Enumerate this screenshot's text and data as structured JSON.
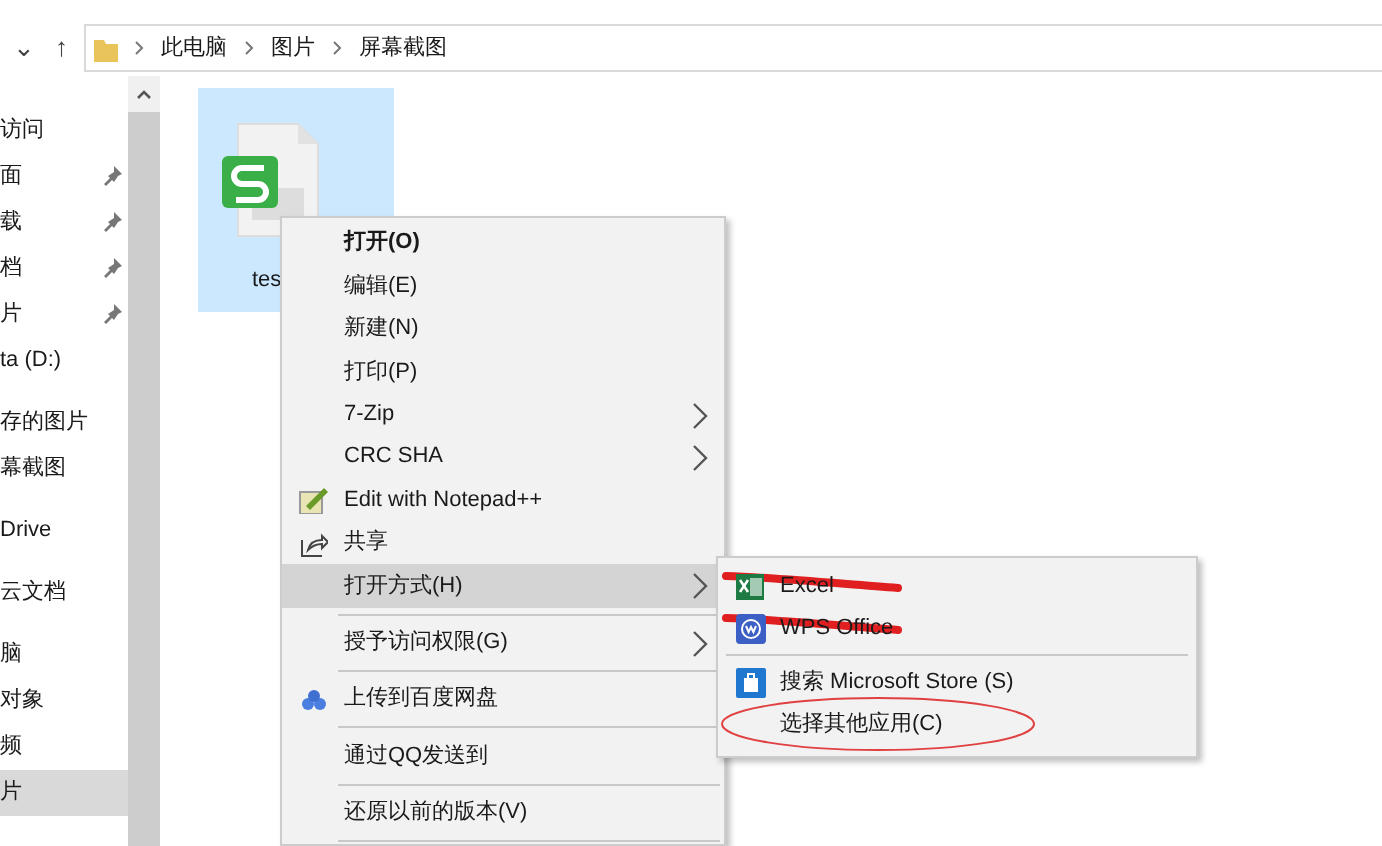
{
  "toolbar": {
    "back_glyph": "⌄",
    "up_glyph": "↑"
  },
  "address_bar": {
    "path": [
      "此电脑",
      "图片",
      "屏幕截图"
    ]
  },
  "nav_pane": {
    "items": [
      {
        "label": "访问",
        "pinned": false,
        "selected": false
      },
      {
        "label": "面",
        "pinned": true,
        "selected": false
      },
      {
        "label": "载",
        "pinned": true,
        "selected": false
      },
      {
        "label": "档",
        "pinned": true,
        "selected": false
      },
      {
        "label": "片",
        "pinned": true,
        "selected": false
      },
      {
        "label": "ta (D:)",
        "pinned": false,
        "selected": false
      },
      {
        "label": "存的图片",
        "pinned": false,
        "selected": false
      },
      {
        "label": "幕截图",
        "pinned": false,
        "selected": false
      },
      {
        "label": "Drive",
        "pinned": false,
        "selected": false
      },
      {
        "label": "云文档",
        "pinned": false,
        "selected": false
      },
      {
        "label": "脑",
        "pinned": false,
        "selected": false
      },
      {
        "label": "对象",
        "pinned": false,
        "selected": false
      },
      {
        "label": "频",
        "pinned": false,
        "selected": false
      },
      {
        "label": "片",
        "pinned": false,
        "selected": true
      }
    ]
  },
  "file": {
    "name": "tes",
    "selected": true
  },
  "context_menu": {
    "items": [
      {
        "kind": "item",
        "label": "打开(O)",
        "bold": true,
        "submenu": false,
        "highlighted": false
      },
      {
        "kind": "item",
        "label": "编辑(E)",
        "bold": false,
        "submenu": false,
        "highlighted": false
      },
      {
        "kind": "item",
        "label": "新建(N)",
        "bold": false,
        "submenu": false,
        "highlighted": false
      },
      {
        "kind": "item",
        "label": "打印(P)",
        "bold": false,
        "submenu": false,
        "highlighted": false
      },
      {
        "kind": "item",
        "label": "7-Zip",
        "bold": false,
        "submenu": true,
        "highlighted": false
      },
      {
        "kind": "item",
        "label": "CRC SHA",
        "bold": false,
        "submenu": true,
        "highlighted": false
      },
      {
        "kind": "item",
        "label": "Edit with Notepad++",
        "bold": false,
        "submenu": false,
        "highlighted": false
      },
      {
        "kind": "item",
        "label": "共享",
        "bold": false,
        "submenu": false,
        "highlighted": false
      },
      {
        "kind": "item",
        "label": "打开方式(H)",
        "bold": false,
        "submenu": true,
        "highlighted": true
      },
      {
        "kind": "separator"
      },
      {
        "kind": "item",
        "label": "授予访问权限(G)",
        "bold": false,
        "submenu": true,
        "highlighted": false
      },
      {
        "kind": "separator"
      },
      {
        "kind": "item",
        "label": "上传到百度网盘",
        "bold": false,
        "submenu": false,
        "highlighted": false
      },
      {
        "kind": "separator"
      },
      {
        "kind": "item",
        "label": "通过QQ发送到",
        "bold": false,
        "submenu": false,
        "highlighted": false
      },
      {
        "kind": "separator"
      },
      {
        "kind": "item",
        "label": "还原以前的版本(V)",
        "bold": false,
        "submenu": false,
        "highlighted": false
      },
      {
        "kind": "separator"
      }
    ]
  },
  "open_with_menu": {
    "items": [
      {
        "kind": "item",
        "label": "Excel",
        "struck": true,
        "circled": false
      },
      {
        "kind": "item",
        "label": "WPS Office",
        "struck": true,
        "circled": false
      },
      {
        "kind": "separator"
      },
      {
        "kind": "item",
        "label": "搜索 Microsoft Store (S)",
        "struck": false,
        "circled": false
      },
      {
        "kind": "item",
        "label": "选择其他应用(C)",
        "struck": false,
        "circled": true
      }
    ]
  }
}
